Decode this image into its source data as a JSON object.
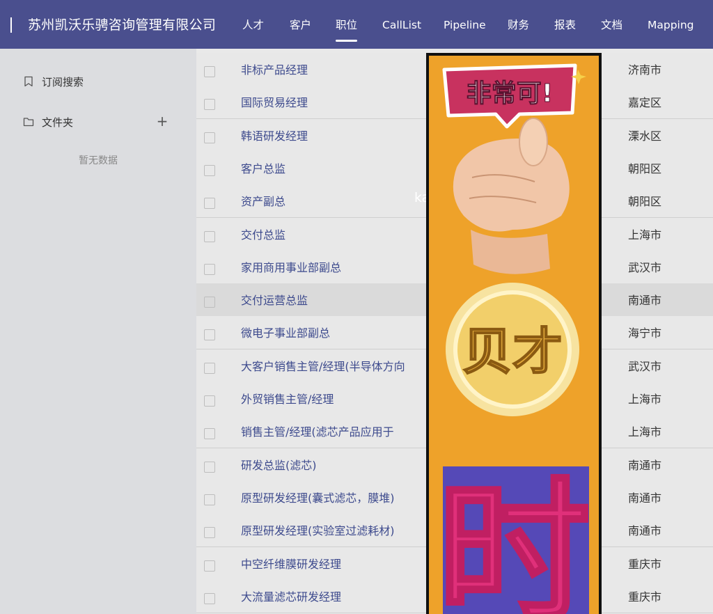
{
  "header": {
    "company": "苏州凯沃乐骋咨询管理有限公司",
    "nav": [
      "人才",
      "客户",
      "职位",
      "CallList",
      "Pipeline",
      "财务",
      "报表",
      "文档",
      "Mapping"
    ],
    "active_nav": "职位"
  },
  "sidebar": {
    "subscribe_label": "订阅搜索",
    "folder_label": "文件夹",
    "add_symbol": "+",
    "empty_text": "暂无数据"
  },
  "overlay_text": "kay.",
  "jobs": [
    {
      "title": "非标产品经理",
      "city": "济南市"
    },
    {
      "title": "国际贸易经理",
      "city": "嘉定区"
    },
    {
      "title": "韩语研发经理",
      "city": "溧水区"
    },
    {
      "title": "客户总监",
      "city": "朝阳区"
    },
    {
      "title": "资产副总",
      "city": "朝阳区"
    },
    {
      "title": "交付总监",
      "city": "上海市"
    },
    {
      "title": "家用商用事业部副总",
      "city": "武汉市"
    },
    {
      "title": "交付运营总监",
      "city": "南通市"
    },
    {
      "title": "微电子事业部副总",
      "city": "海宁市"
    },
    {
      "title": "大客户销售主管/经理(半导体方向",
      "city": "武汉市"
    },
    {
      "title": "外贸销售主管/经理",
      "city": "上海市"
    },
    {
      "title": "销售主管/经理(滤芯产品应用于",
      "city": "上海市"
    },
    {
      "title": "研发总监(滤芯)",
      "city": "南通市"
    },
    {
      "title": "原型研发经理(囊式滤芯，膜堆)",
      "city": "南通市"
    },
    {
      "title": "原型研发经理(实验室过滤耗材)",
      "city": "南通市"
    },
    {
      "title": "中空纤维膜研发经理",
      "city": "重庆市"
    },
    {
      "title": "大流量滤芯研发经理",
      "city": "重庆市"
    }
  ],
  "ad": {
    "badge_text": "非常可!",
    "coin_text": "贝才",
    "big_char": "时"
  },
  "colors": {
    "header_bg": "#4a4f8e",
    "link": "#3d4a8d",
    "ad_bg": "#eea22a",
    "badge": "#c8325f",
    "big_char": "#e0307a"
  }
}
